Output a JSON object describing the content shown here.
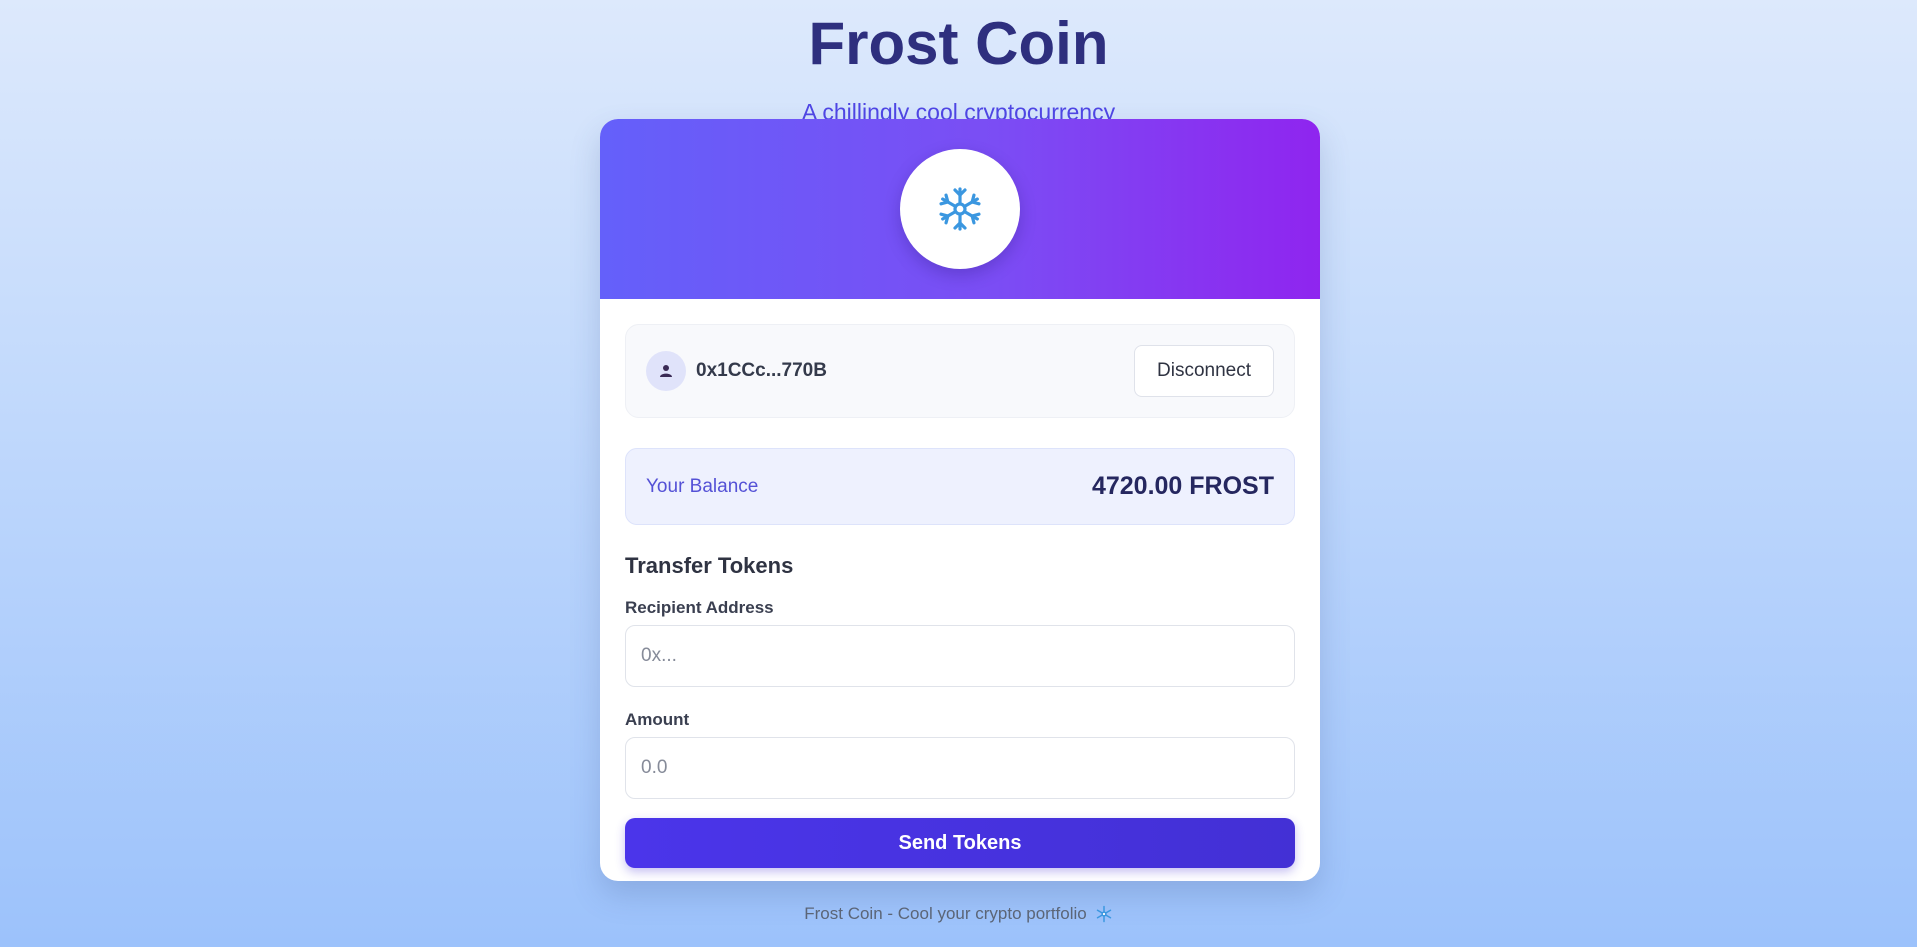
{
  "header": {
    "title": "Frost Coin",
    "subtitle": "A chillingly cool cryptocurrency"
  },
  "card": {
    "logo_icon": "snowflake-icon",
    "wallet": {
      "avatar_icon": "user-icon",
      "address": "0x1CCc...770B",
      "disconnect_label": "Disconnect"
    },
    "balance": {
      "label": "Your Balance",
      "value": "4720.00 FROST"
    },
    "transfer": {
      "title": "Transfer Tokens",
      "recipient_label": "Recipient Address",
      "recipient_placeholder": "0x...",
      "amount_label": "Amount",
      "amount_placeholder": "0.0",
      "send_label": "Send Tokens"
    }
  },
  "footer": {
    "text": "Frost Coin - Cool your crypto portfolio",
    "icon": "snowflake-icon"
  },
  "colors": {
    "title": "#2e2f7e",
    "accent": "#4f46e5",
    "banner_start": "#6460fa",
    "banner_end": "#8f25ef",
    "snowflake": "#3b97e0"
  }
}
